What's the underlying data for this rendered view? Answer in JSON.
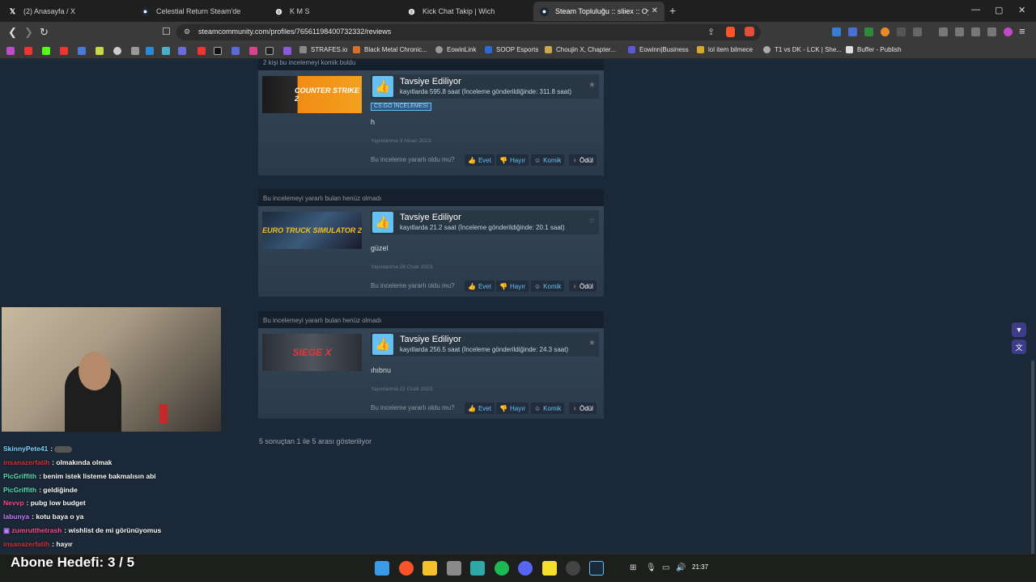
{
  "tabs": [
    {
      "title": "(2) Anasayfa / X",
      "icon": "x-logo-icon"
    },
    {
      "title": "Celestial Return Steam'de",
      "icon": "steam-icon"
    },
    {
      "title": "K M S",
      "icon": "globe-icon"
    },
    {
      "title": "Kick Chat Takip | Wich",
      "icon": "globe-icon"
    },
    {
      "title": "Steam Topluluğu :: sliiex :: Oyunl",
      "icon": "steam-icon",
      "active": true
    }
  ],
  "address": {
    "url": "steamcommunity.com/profiles/76561198400732332/reviews"
  },
  "bookmarks": [
    "STRAFES.io",
    "Black Metal Chronic...",
    "EowinLink",
    "SOOP Esports",
    "Choujin X, Chapter...",
    "Eowinn|Business",
    "lol item bilmece",
    "T1 vs DK - LCK | She...",
    "Buffer - Publish"
  ],
  "reviews": [
    {
      "top_text": "2 kişi bu incelemeyi komik buldu",
      "game": "COUNTER STRIKE 2",
      "rec": "Tavsiye Ediliyor",
      "hours": "kayıtlarda 595.8 saat (İnceleme gönderildiğinde: 311.8 saat)",
      "badge": "CS:GO İNCELEMESİ",
      "text": "h",
      "date": "Yayınlanma 9 Nisan 2023.",
      "helpful": "Bu inceleme yararlı oldu mu?",
      "btn_yes": "Evet",
      "btn_no": "Hayır",
      "btn_funny": "Komik",
      "btn_award": "Ödül"
    },
    {
      "top_text": "Bu incelemeyi yararlı bulan henüz olmadı",
      "game": "EURO TRUCK SIMULATOR 2",
      "rec": "Tavsiye Ediliyor",
      "hours": "kayıtlarda 21.2 saat (İnceleme gönderildiğinde: 20.1 saat)",
      "text": "güzel",
      "date": "Yayınlanma 28 Ocak 2023.",
      "helpful": "Bu inceleme yararlı oldu mu?",
      "btn_yes": "Evet",
      "btn_no": "Hayır",
      "btn_funny": "Komik",
      "btn_award": "Ödül"
    },
    {
      "top_text": "Bu incelemeyi yararlı bulan henüz olmadı",
      "game": "SIEGE X",
      "rec": "Tavsiye Ediliyor",
      "hours": "kayıtlarda 256.5 saat (İnceleme gönderildiğinde: 24.3 saat)",
      "text": "ıhıbnu",
      "date": "Yayınlanma 21 Ocak 2020.",
      "helpful": "Bu inceleme yararlı oldu mu?",
      "btn_yes": "Evet",
      "btn_no": "Hayır",
      "btn_funny": "Komik",
      "btn_award": "Ödül"
    }
  ],
  "results_text": "5 sonuçtan 1 ile 5 arası gösteriliyor",
  "chat": [
    {
      "nick": "SkinnyPete41",
      "msg": "",
      "color": "#7fd8ff"
    },
    {
      "nick": "insanazerfatih",
      "msg": "olmakında olmak",
      "color": "#e0303a"
    },
    {
      "nick": "PicGriffith",
      "msg": "benim istek listeme bakmalısın abi",
      "color": "#55e0b4"
    },
    {
      "nick": "PicGriffith",
      "msg": "geldiğinde",
      "color": "#55e0b4"
    },
    {
      "nick": "Nevvp",
      "msg": "pubg low budget",
      "color": "#ff4a8a"
    },
    {
      "nick": "labunya",
      "msg": "kotu baya o ya",
      "color": "#c77dff"
    },
    {
      "nick": "zumrutthetrash",
      "msg": "wishlist de mi görünüyomus",
      "color": "#ff4a8a"
    },
    {
      "nick": "insanazerfatih",
      "msg": "hayır",
      "color": "#e0303a"
    }
  ],
  "abone": "Abone Hedefi:  3 / 5",
  "clock": "21:37",
  "colors": {
    "accent": "#66c0f4",
    "page_bg": "#1b2838"
  }
}
